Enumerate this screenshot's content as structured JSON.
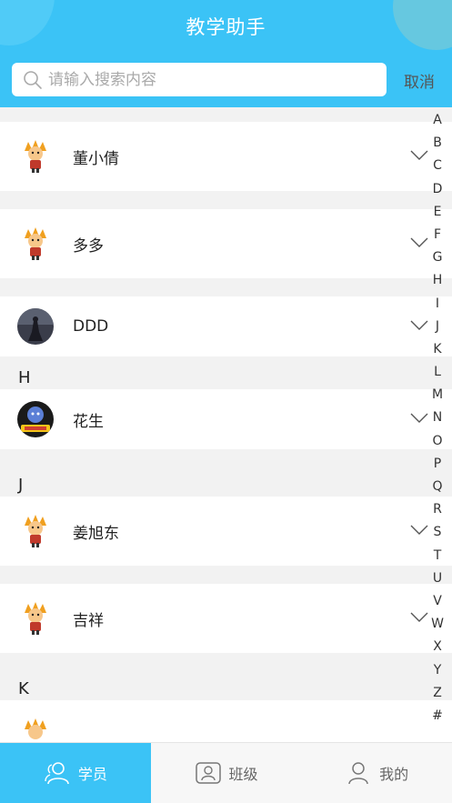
{
  "header": {
    "title": "教学助手",
    "cancel_label": "取消"
  },
  "search": {
    "placeholder": "请输入搜索内容"
  },
  "contacts": [
    {
      "name": "董小倩",
      "avatar": "cartoon-avatar"
    },
    {
      "name": "多多",
      "avatar": "cartoon-avatar"
    },
    {
      "name": "DDD",
      "avatar": "photo-avatar"
    },
    {
      "section": "H"
    },
    {
      "name": "花生",
      "avatar": "game-avatar"
    },
    {
      "section": "J"
    },
    {
      "name": "姜旭东",
      "avatar": "cartoon-avatar"
    },
    {
      "name": "吉祥",
      "avatar": "cartoon-avatar"
    },
    {
      "section": "K"
    }
  ],
  "index_letters": [
    "A",
    "B",
    "C",
    "D",
    "E",
    "F",
    "G",
    "H",
    "I",
    "J",
    "K",
    "L",
    "M",
    "N",
    "O",
    "P",
    "Q",
    "R",
    "S",
    "T",
    "U",
    "V",
    "W",
    "X",
    "Y",
    "Z",
    "#"
  ],
  "tabs": [
    {
      "label": "学员",
      "icon": "students-icon",
      "active": true
    },
    {
      "label": "班级",
      "icon": "class-icon",
      "active": false
    },
    {
      "label": "我的",
      "icon": "profile-icon",
      "active": false
    }
  ],
  "colors": {
    "accent": "#3bc3f6",
    "background": "#f2f2f2"
  }
}
